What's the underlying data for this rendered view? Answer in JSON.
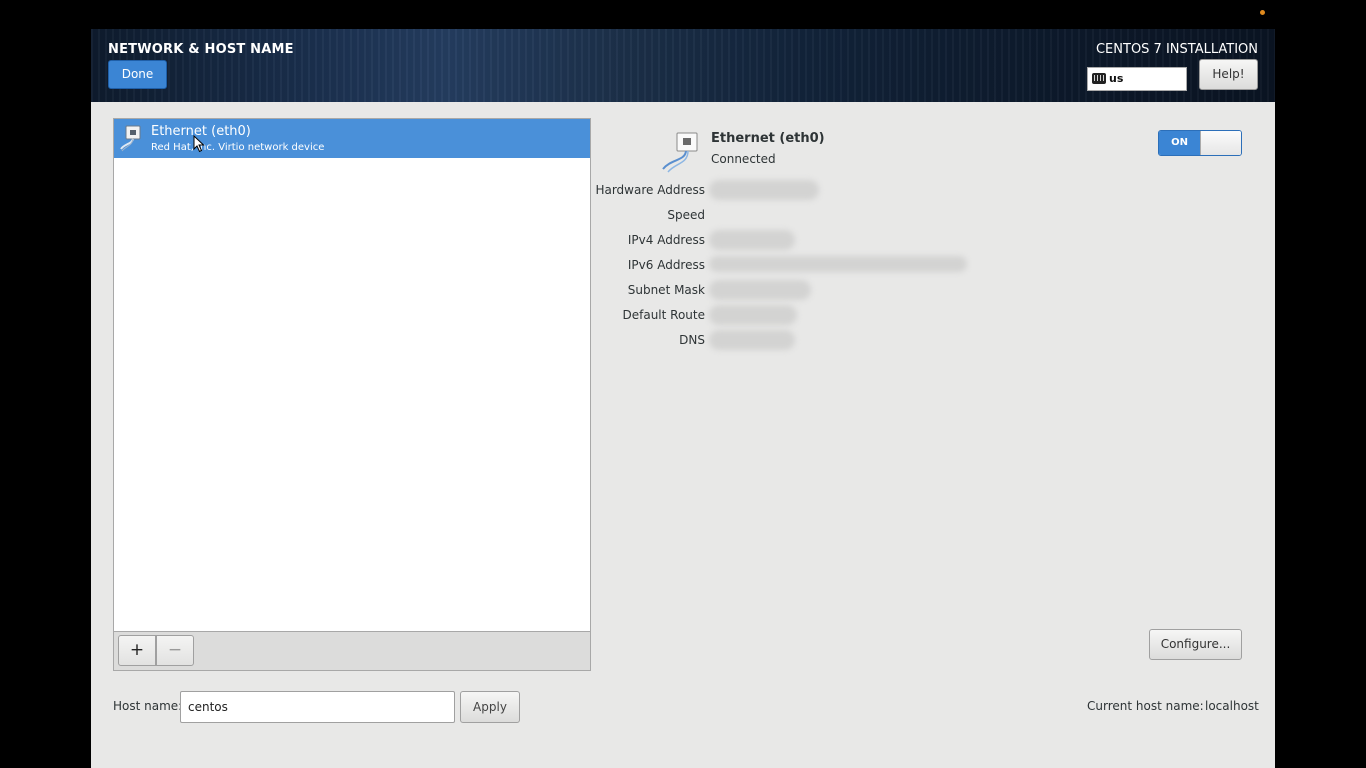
{
  "header": {
    "page_title": "NETWORK & HOST NAME",
    "done_label": "Done",
    "product_title": "CENTOS 7 INSTALLATION",
    "keyboard_layout": "us",
    "help_label": "Help!"
  },
  "device_list": {
    "items": [
      {
        "name": "Ethernet (eth0)",
        "description": "Red Hat, Inc. Virtio network device",
        "icon": "ethernet-icon",
        "selected": true
      }
    ],
    "add_label": "+",
    "remove_label": "−"
  },
  "details": {
    "name": "Ethernet (eth0)",
    "status": "Connected",
    "toggle_label": "ON",
    "properties": [
      {
        "label": "Hardware Address"
      },
      {
        "label": "Speed"
      },
      {
        "label": "IPv4 Address"
      },
      {
        "label": "IPv6 Address"
      },
      {
        "label": "Subnet Mask"
      },
      {
        "label": "Default Route"
      },
      {
        "label": "DNS"
      }
    ],
    "configure_label": "Configure..."
  },
  "hostname": {
    "label": "Host name:",
    "value": "centos",
    "apply_label": "Apply",
    "current_label": "Current host name:",
    "current_value": "localhost"
  },
  "colors": {
    "accent": "#3b85d4",
    "selection": "#4a90d9",
    "background": "#e8e8e7"
  }
}
